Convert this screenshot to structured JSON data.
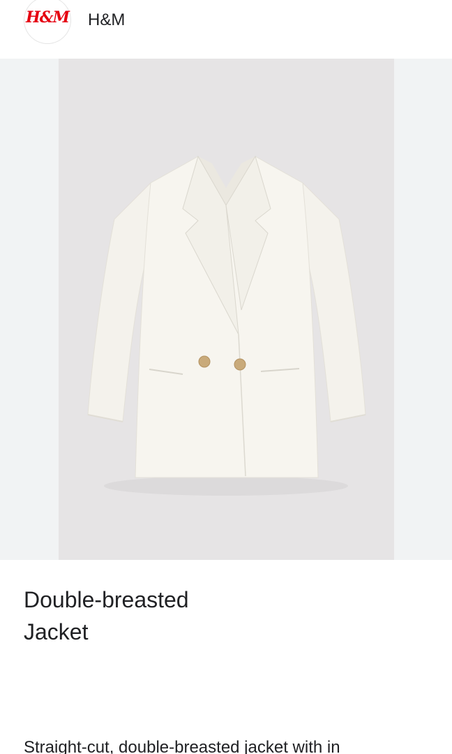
{
  "brand": {
    "logo_text": "H&M",
    "name": "H&M",
    "logo_color": "#e50010"
  },
  "product": {
    "image_alt": "White double-breasted jacket",
    "title": "Double-breasted Jacket",
    "description": "Straight-cut, double-breasted jacket with in"
  },
  "colors": {
    "image_background": "#e6e4e5",
    "band_background": "#f1f3f4",
    "text": "#202124"
  }
}
